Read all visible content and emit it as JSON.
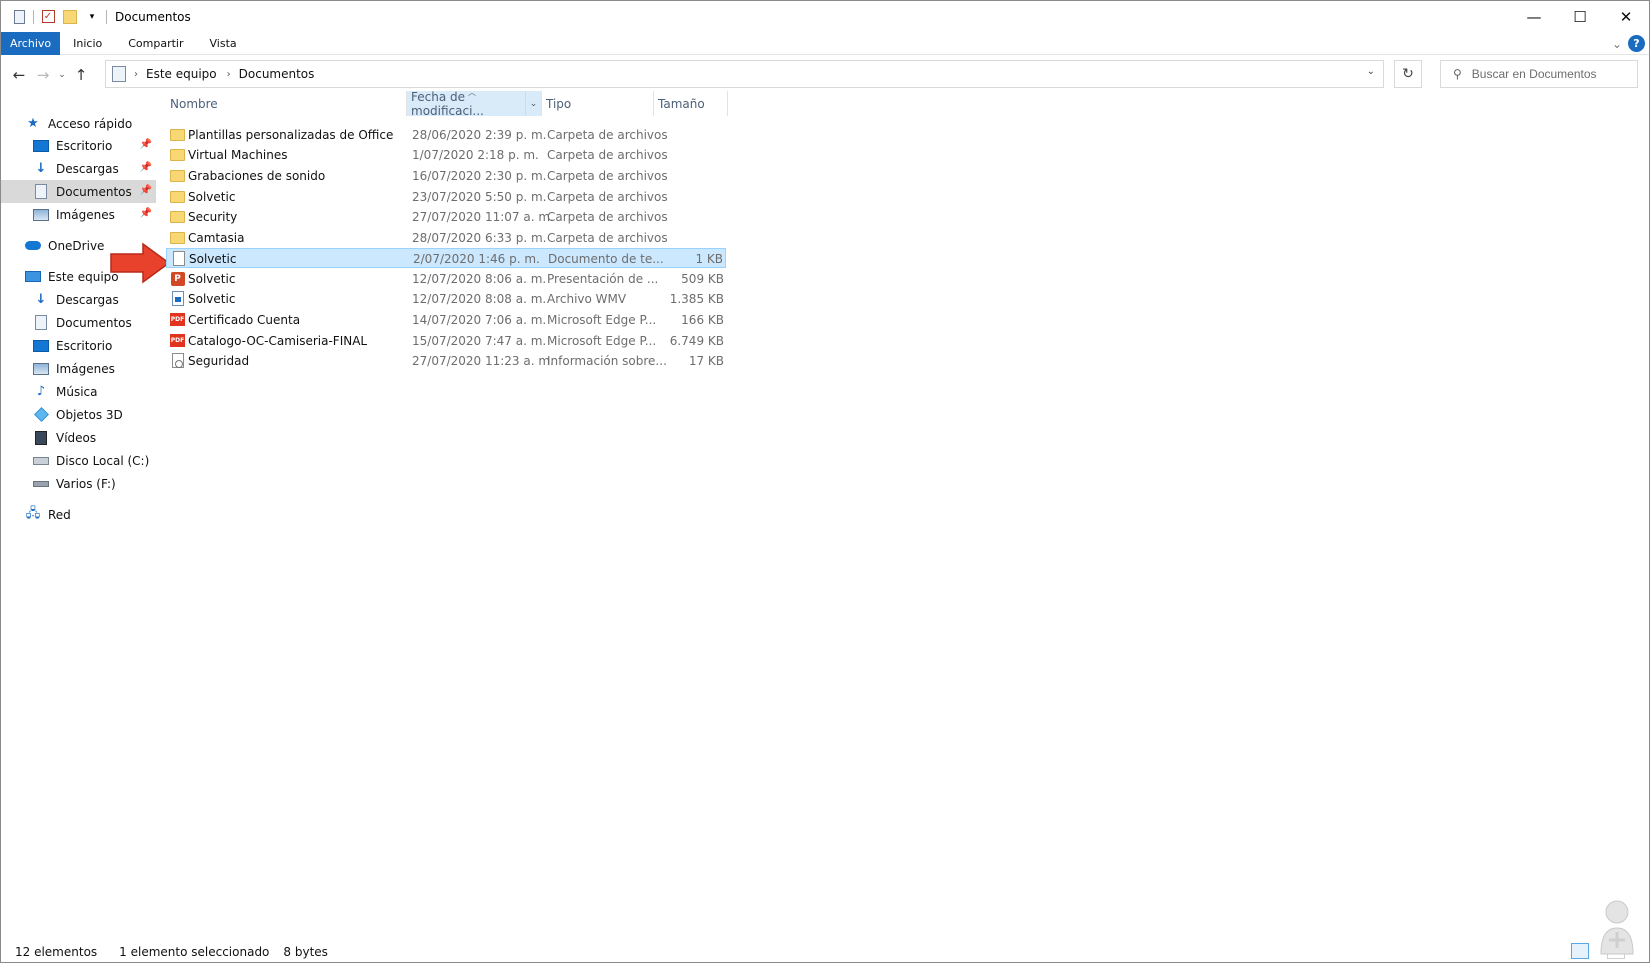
{
  "window": {
    "title": "Documentos",
    "controls": {
      "minimize": "—",
      "maximize": "☐",
      "close": "✕"
    }
  },
  "quick_access_toolbar": {
    "icons": [
      "properties-icon",
      "checkmark-icon",
      "new-folder-icon",
      "customize-dropdown-icon"
    ]
  },
  "ribbon": {
    "tabs": [
      {
        "label": "Archivo",
        "active": true
      },
      {
        "label": "Inicio"
      },
      {
        "label": "Compartir"
      },
      {
        "label": "Vista"
      }
    ],
    "expand_icon": "⌄",
    "help_label": "?"
  },
  "navigation": {
    "back": "←",
    "forward": "→",
    "recent": "⌄",
    "up": "↑",
    "breadcrumb": [
      "Este equipo",
      "Documentos"
    ],
    "refresh": "↻"
  },
  "search": {
    "placeholder": "Buscar en Documentos"
  },
  "sidebar": {
    "quick_access": {
      "label": "Acceso rápido",
      "items": [
        {
          "label": "Escritorio",
          "pinned": true,
          "icon": "desktop-icon"
        },
        {
          "label": "Descargas",
          "pinned": true,
          "icon": "downloads-icon"
        },
        {
          "label": "Documentos",
          "pinned": true,
          "selected": true,
          "icon": "documents-icon"
        },
        {
          "label": "Imágenes",
          "pinned": true,
          "icon": "pictures-icon"
        }
      ]
    },
    "onedrive": {
      "label": "OneDrive"
    },
    "this_pc": {
      "label": "Este equipo",
      "items": [
        {
          "label": "Descargas",
          "icon": "downloads-icon"
        },
        {
          "label": "Documentos",
          "icon": "documents-icon"
        },
        {
          "label": "Escritorio",
          "icon": "desktop-icon"
        },
        {
          "label": "Imágenes",
          "icon": "pictures-icon"
        },
        {
          "label": "Música",
          "icon": "music-icon"
        },
        {
          "label": "Objetos 3D",
          "icon": "3d-objects-icon"
        },
        {
          "label": "Vídeos",
          "icon": "videos-icon"
        },
        {
          "label": "Disco Local (C:)",
          "icon": "local-disk-icon"
        },
        {
          "label": "Varios (F:)",
          "icon": "drive-icon"
        }
      ]
    },
    "network": {
      "label": "Red"
    }
  },
  "file_list": {
    "columns": {
      "name": "Nombre",
      "date": "Fecha de modificaci...",
      "type": "Tipo",
      "size": "Tamaño"
    },
    "sorted_by": "date",
    "rows": [
      {
        "name": "Plantillas personalizadas de Office",
        "date": "28/06/2020 2:39 p. m.",
        "type": "Carpeta de archivos",
        "size": "",
        "icon": "folder"
      },
      {
        "name": "Virtual Machines",
        "date": "1/07/2020 2:18 p. m.",
        "type": "Carpeta de archivos",
        "size": "",
        "icon": "folder"
      },
      {
        "name": "Grabaciones de sonido",
        "date": "16/07/2020 2:30 p. m.",
        "type": "Carpeta de archivos",
        "size": "",
        "icon": "folder"
      },
      {
        "name": "Solvetic",
        "date": "23/07/2020 5:50 p. m.",
        "type": "Carpeta de archivos",
        "size": "",
        "icon": "folder"
      },
      {
        "name": "Security",
        "date": "27/07/2020 11:07 a. m.",
        "type": "Carpeta de archivos",
        "size": "",
        "icon": "folder"
      },
      {
        "name": "Camtasia",
        "date": "28/07/2020 6:33 p. m.",
        "type": "Carpeta de archivos",
        "size": "",
        "icon": "folder"
      },
      {
        "name": "Solvetic",
        "date": "2/07/2020 1:46 p. m.",
        "type": "Documento de te...",
        "size": "1 KB",
        "icon": "text",
        "selected": true
      },
      {
        "name": "Solvetic",
        "date": "12/07/2020 8:06 a. m.",
        "type": "Presentación de ...",
        "size": "509 KB",
        "icon": "powerpoint"
      },
      {
        "name": "Solvetic",
        "date": "12/07/2020 8:08 a. m.",
        "type": "Archivo WMV",
        "size": "1.385 KB",
        "icon": "video"
      },
      {
        "name": "Certificado Cuenta",
        "date": "14/07/2020 7:06 a. m.",
        "type": "Microsoft Edge P...",
        "size": "166 KB",
        "icon": "pdf"
      },
      {
        "name": "Catalogo-OC-Camiseria-FINAL",
        "date": "15/07/2020 7:47 a. m.",
        "type": "Microsoft Edge P...",
        "size": "6.749 KB",
        "icon": "pdf"
      },
      {
        "name": "Seguridad",
        "date": "27/07/2020 11:23 a. m.",
        "type": "Información sobre...",
        "size": "17 KB",
        "icon": "setup-info"
      }
    ]
  },
  "status_bar": {
    "item_count": "12 elementos",
    "selection": "1 elemento seleccionado",
    "selection_size": "8 bytes"
  },
  "annotation": {
    "icon": "red-arrow-icon",
    "color": "#e8412c"
  },
  "colors": {
    "accent": "#1a6cc1",
    "selection": "#cce8ff",
    "selection_border": "#99d1ff",
    "folder": "#f8d775"
  }
}
